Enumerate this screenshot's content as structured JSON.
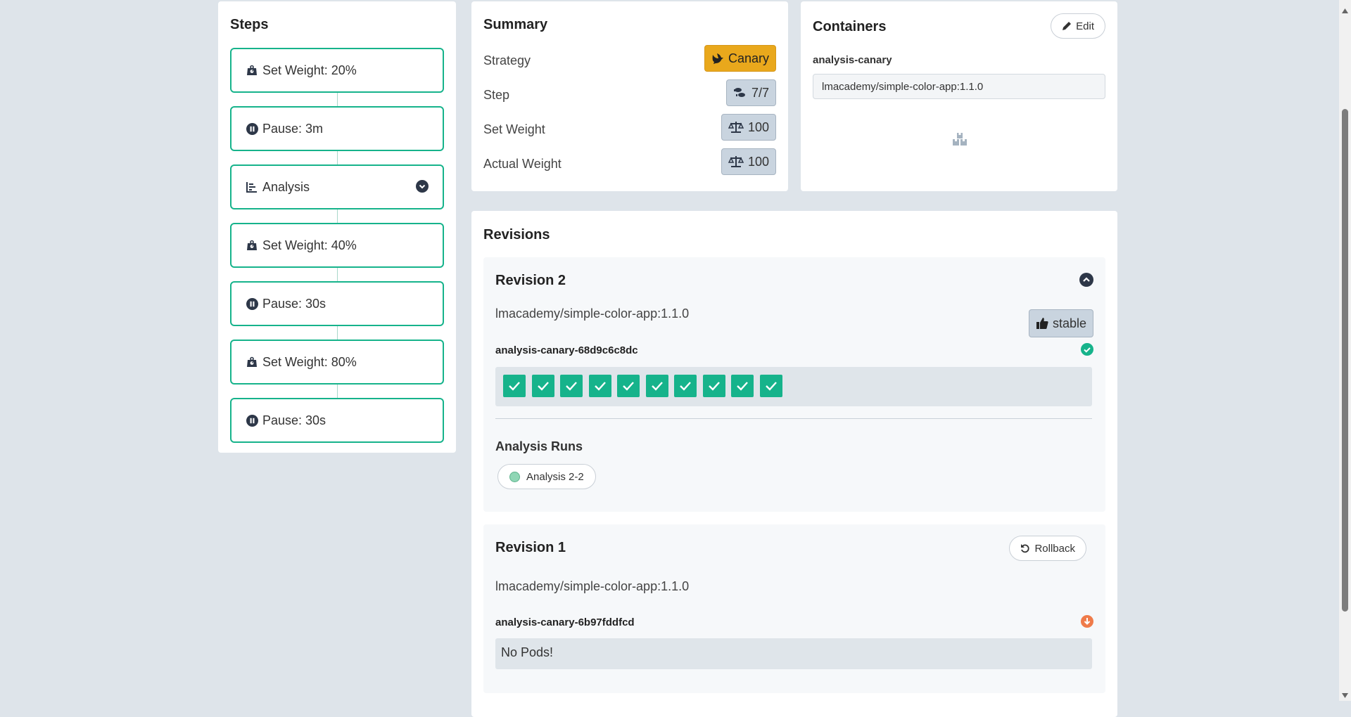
{
  "steps": {
    "title": "Steps",
    "items": [
      {
        "label": "Set Weight: 20%",
        "icon": "weight-icon"
      },
      {
        "label": "Pause: 3m",
        "icon": "pause-icon"
      },
      {
        "label": "Analysis",
        "icon": "chart-icon",
        "expandable": true
      },
      {
        "label": "Set Weight: 40%",
        "icon": "weight-icon"
      },
      {
        "label": "Pause: 30s",
        "icon": "pause-icon"
      },
      {
        "label": "Set Weight: 80%",
        "icon": "weight-icon"
      },
      {
        "label": "Pause: 30s",
        "icon": "pause-icon"
      }
    ]
  },
  "summary": {
    "title": "Summary",
    "rows": [
      {
        "label": "Strategy",
        "value": "Canary",
        "icon": "dove-icon"
      },
      {
        "label": "Step",
        "value": "7/7",
        "icon": "shoe-prints-icon"
      },
      {
        "label": "Set Weight",
        "value": "100",
        "icon": "balance-scale-icon"
      },
      {
        "label": "Actual Weight",
        "value": "100",
        "icon": "balance-scale-icon"
      }
    ]
  },
  "containers": {
    "title": "Containers",
    "edit_label": "Edit",
    "name": "analysis-canary",
    "image": "lmacademy/simple-color-app:1.1.0"
  },
  "revisions": {
    "title": "Revisions",
    "items": [
      {
        "title": "Revision 2",
        "image": "lmacademy/simple-color-app:1.1.0",
        "badge": "stable",
        "replicaset": "analysis-canary-68d9c6c8dc",
        "pods_healthy": 10,
        "analysis_runs_title": "Analysis Runs",
        "analysis_run": "Analysis 2-2"
      },
      {
        "title": "Revision 1",
        "image": "lmacademy/simple-color-app:1.1.0",
        "action": "Rollback",
        "replicaset": "analysis-canary-6b97fddfcd",
        "no_pods": "No Pods!"
      }
    ]
  },
  "colors": {
    "accent": "#16b38b",
    "canary": "#e9a81c",
    "scaled_down": "#ef7b4a"
  }
}
